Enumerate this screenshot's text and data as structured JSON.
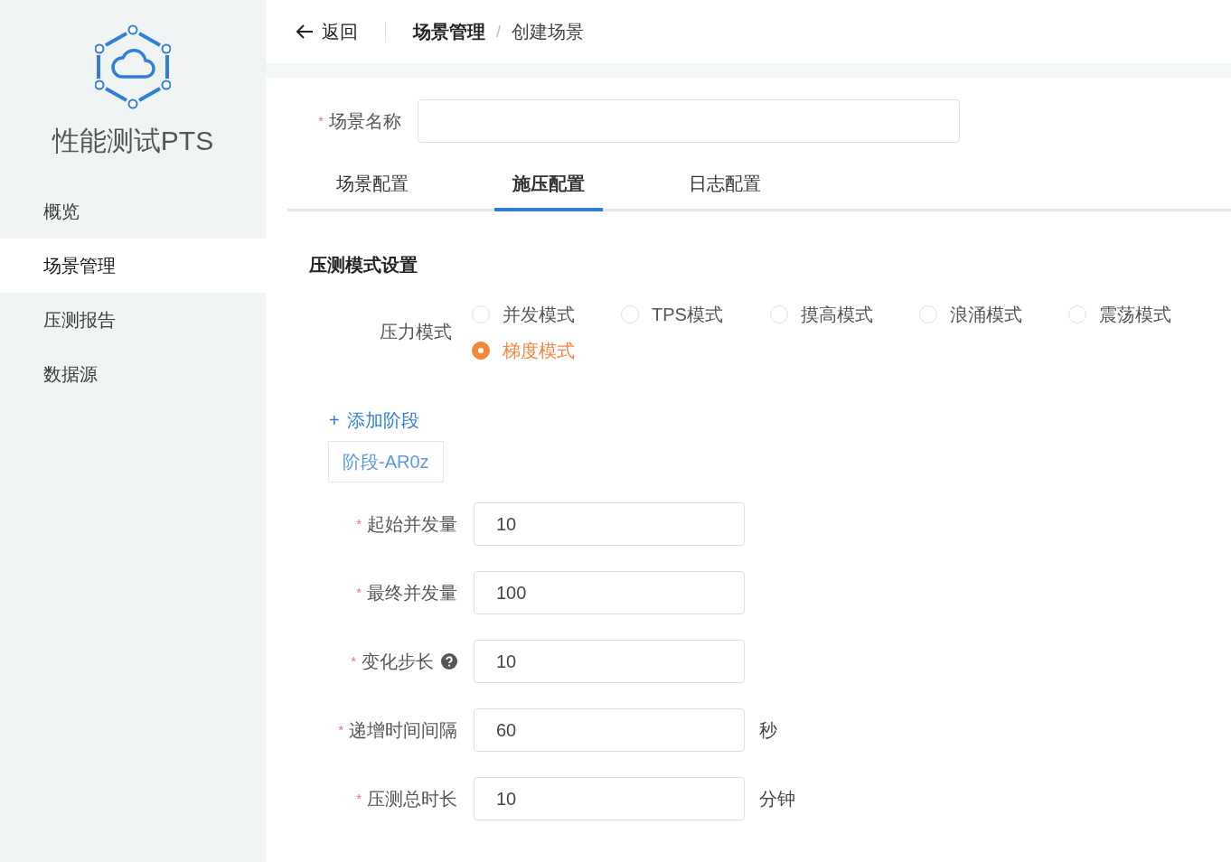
{
  "sidebar": {
    "app_title": "性能测试PTS",
    "items": [
      {
        "label": "概览",
        "selected": false
      },
      {
        "label": "场景管理",
        "selected": true
      },
      {
        "label": "压测报告",
        "selected": false
      },
      {
        "label": "数据源",
        "selected": false
      }
    ]
  },
  "header": {
    "back": "返回",
    "breadcrumb": [
      {
        "label": "场景管理"
      },
      {
        "label": "创建场景"
      }
    ],
    "separator": "/"
  },
  "scene_name": {
    "mark": "*",
    "label": "场景名称"
  },
  "tabs": [
    {
      "label": "场景配置",
      "selected": false
    },
    {
      "label": "施压配置",
      "selected": true
    },
    {
      "label": "日志配置",
      "selected": false
    }
  ],
  "section_title": "压测模式设置",
  "pressure_mode": {
    "label": "压力模式",
    "options": [
      {
        "label": "并发模式",
        "selected": false
      },
      {
        "label": "TPS模式",
        "selected": false
      },
      {
        "label": "摸高模式",
        "selected": false
      },
      {
        "label": "浪涌模式",
        "selected": false
      },
      {
        "label": "震荡模式",
        "selected": false
      },
      {
        "label": "梯度模式",
        "selected": true
      }
    ]
  },
  "add_stage": {
    "icon": "+",
    "label": "添加阶段"
  },
  "stage_tabs": [
    {
      "label": "阶段-AR0z"
    }
  ],
  "fields": [
    {
      "mark": "*",
      "label": "起始并发量",
      "value": "10"
    },
    {
      "mark": "*",
      "label": "最终并发量",
      "value": "100"
    },
    {
      "mark": "*",
      "label": "变化步长",
      "help": true,
      "value": "10"
    },
    {
      "mark": "*",
      "label": "递增时间间隔",
      "value": "60",
      "unit": "秒"
    },
    {
      "mark": "*",
      "label": "压测总时长",
      "value": "10",
      "unit": "分钟"
    }
  ]
}
